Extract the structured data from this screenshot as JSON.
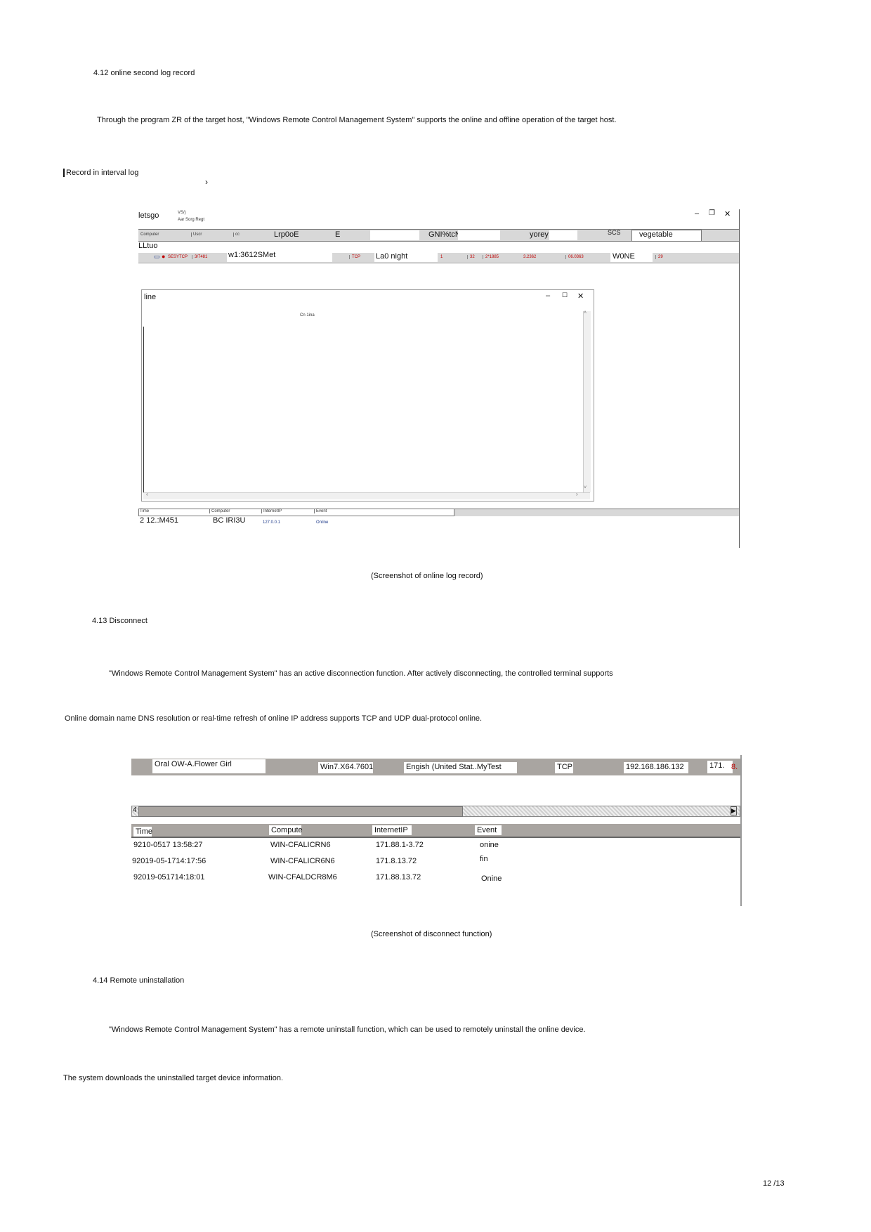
{
  "page": {
    "heading_412": "4.12 online second log record",
    "para_412": "Through the program ZR of the target host, \"Windows Remote Control Management System\" supports the online and offline operation of the target host.",
    "record_label": "Record in interval log",
    "caption_1": "(Screenshot of online log record)",
    "heading_413": "4.13 Disconnect",
    "para_413": "\"Windows Remote Control Management System\" has an active disconnection function. After actively disconnecting, the controlled terminal supports",
    "para_413b": "Online domain name DNS resolution or real-time refresh of online IP address supports TCP and UDP dual-protocol online.",
    "caption_2": "(Screenshot of disconnect function)",
    "heading_414": "4.14 Remote uninstallation",
    "para_414": "\"Windows Remote Control Management System\" has a remote uninstall function, which can be used to remotely uninstall the online device.",
    "para_414b": "The system downloads the uninstalled target device information.",
    "page_number": "12 /13"
  },
  "screenshot1": {
    "window_title": "letsgo",
    "title_small": "VS/)",
    "menu": "Aar  Sorg  Regt",
    "header_cells": [
      "Computer",
      "Uscr",
      "cc",
      "Lrp0oE",
      "E",
      "GNI%tcN",
      "yorey",
      "SCS",
      "vegetable"
    ],
    "subheader": "LLtuo",
    "row_cells": [
      "SESYTCP",
      "3/7481",
      "w1:3612SMet",
      "TCP",
      "La0 night",
      "1",
      "32",
      "2*1885",
      "3.2362",
      "06.0363",
      "W0NE",
      "29"
    ],
    "dialog_title": "line",
    "dialog_heading": "Cn 1ina",
    "log_headers": [
      "Time",
      "Computer",
      "InternetIP",
      "Event"
    ],
    "log_row": [
      "2 12.:M451",
      "BC IRI3U",
      "127.0.0.1",
      "Online"
    ],
    "window_controls": [
      "–",
      "❐",
      "✕"
    ],
    "dialog_controls": [
      "–",
      "☐",
      "✕"
    ]
  },
  "screenshot2": {
    "row_cells": [
      "Oral OW-A.Flower Girl",
      "Win7.X64.7601",
      "Engish (United Stat..MyTest",
      "TCP",
      "192.168.186.132",
      "171.",
      "8."
    ],
    "scroll_left": "4",
    "scroll_right": "▶",
    "log_headers": [
      "Time",
      "Compute",
      "InternetIP",
      "Event"
    ],
    "log_rows": [
      [
        "9210-0517 13:58:27",
        "WIN-CFALICRN6",
        "171.88.1-3.72",
        "onine"
      ],
      [
        "92019-05-1714:17:56",
        "WIN-CFALICR6N6",
        "171.8.13.72",
        "fin"
      ],
      [
        "92019-051714:18:01",
        "WIN-CFALDCR8M6",
        "171.88.13.72",
        "Onine"
      ]
    ]
  }
}
